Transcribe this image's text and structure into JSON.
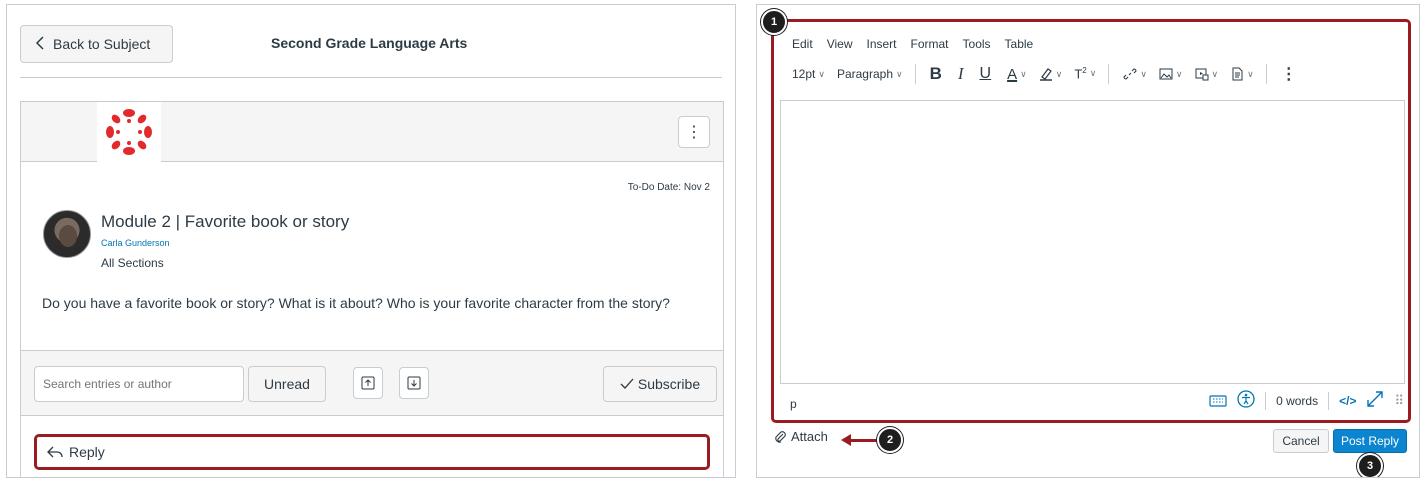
{
  "left": {
    "back_label": "Back to Subject",
    "subject_title": "Second Grade Language Arts",
    "kebab_label": "⋮",
    "todo_date": "To-Do Date: Nov 2",
    "post": {
      "title": "Module 2 | Favorite book or story",
      "author": "Carla Gunderson",
      "sections": "All Sections",
      "body": "Do you have a favorite book or story? What is it about? Who is your favorite character from the story?"
    },
    "search_placeholder": "Search entries or author",
    "unread_label": "Unread",
    "subscribe_label": "Subscribe",
    "reply_label": "Reply",
    "accent_color": "#9b1c20",
    "brand_color": "#e2292b"
  },
  "right": {
    "menu": [
      "Edit",
      "View",
      "Insert",
      "Format",
      "Tools",
      "Table"
    ],
    "font_size": "12pt",
    "block_format": "Paragraph",
    "toolbar_icons": [
      "bold-icon",
      "italic-icon",
      "underline-icon",
      "text-color-icon",
      "highlight-icon",
      "superscript-icon",
      "link-icon",
      "image-icon",
      "media-icon",
      "document-icon",
      "more-icon"
    ],
    "status_path": "p",
    "word_count": "0 words",
    "html_toggle": "</>",
    "attach_label": "Attach",
    "cancel_label": "Cancel",
    "post_reply_label": "Post Reply",
    "primary_color": "#0c85d0"
  },
  "callouts": [
    "1",
    "2",
    "3"
  ]
}
